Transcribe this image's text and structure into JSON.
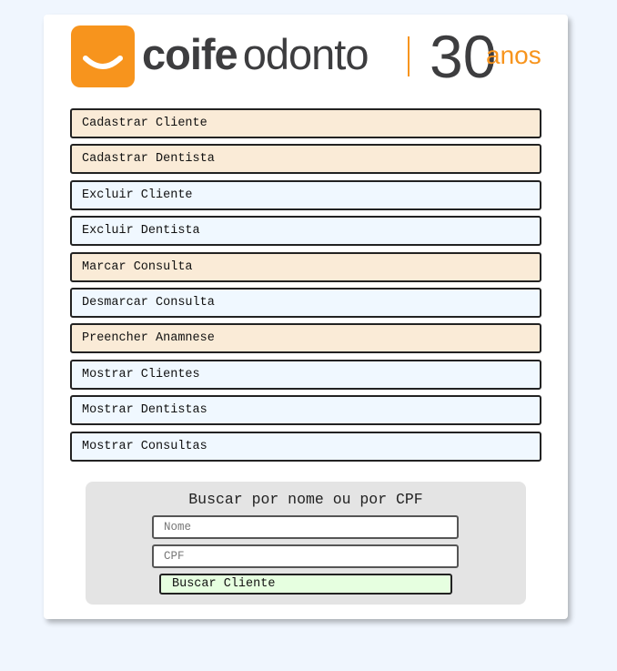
{
  "brand": {
    "name_bold": "coife",
    "name_light": "odonto",
    "anniversary_number": "30",
    "anniversary_word": "anos",
    "colors": {
      "orange": "#f7941d",
      "charcoal": "#3d3d3f"
    }
  },
  "menu": {
    "items": [
      {
        "label": "Cadastrar Cliente",
        "color": "#faebd7"
      },
      {
        "label": "Cadastrar Dentista",
        "color": "#faebd7"
      },
      {
        "label": "Excluir Cliente",
        "color": "#f0f8ff"
      },
      {
        "label": "Excluir Dentista",
        "color": "#f0f8ff"
      },
      {
        "label": "Marcar Consulta",
        "color": "#faebd7"
      },
      {
        "label": "Desmarcar Consulta",
        "color": "#f0f8ff"
      },
      {
        "label": "Preencher Anamnese",
        "color": "#faebd7"
      },
      {
        "label": "Mostrar Clientes",
        "color": "#f0f8ff"
      },
      {
        "label": "Mostrar Dentistas",
        "color": "#f0f8ff"
      },
      {
        "label": "Mostrar Consultas",
        "color": "#f0f8ff"
      }
    ]
  },
  "search": {
    "title": "Buscar por nome ou por CPF",
    "name_placeholder": "Nome",
    "name_value": "",
    "cpf_placeholder": "CPF",
    "cpf_value": "",
    "button_label": "Buscar Cliente",
    "button_color": "#e6ffe0"
  }
}
